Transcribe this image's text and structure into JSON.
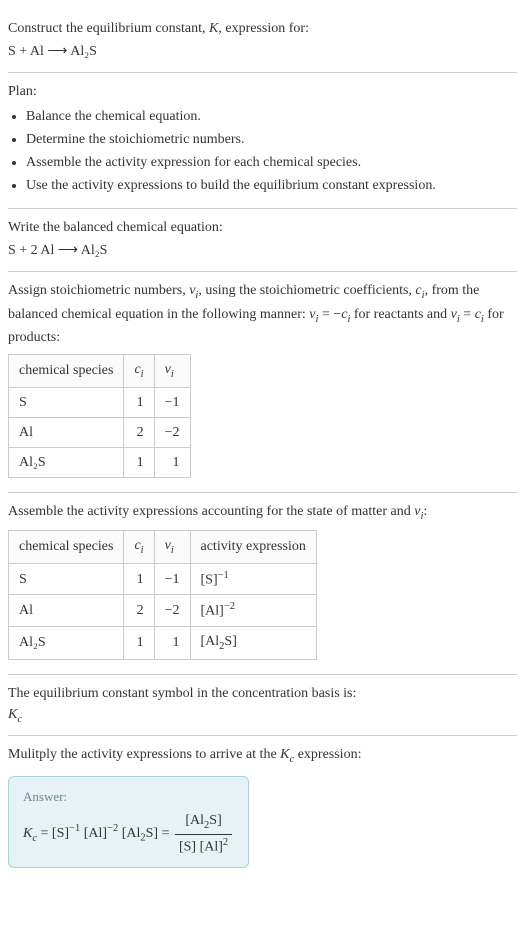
{
  "intro": {
    "line1": "Construct the equilibrium constant, K, expression for:",
    "line2": "S + Al ⟶ Al₂S"
  },
  "plan": {
    "heading": "Plan:",
    "items": [
      "Balance the chemical equation.",
      "Determine the stoichiometric numbers.",
      "Assemble the activity expression for each chemical species.",
      "Use the activity expressions to build the equilibrium constant expression."
    ]
  },
  "balanced": {
    "heading": "Write the balanced chemical equation:",
    "equation": "S + 2 Al ⟶ Al₂S"
  },
  "stoich": {
    "text": "Assign stoichiometric numbers, νᵢ, using the stoichiometric coefficients, cᵢ, from the balanced chemical equation in the following manner: νᵢ = −cᵢ for reactants and νᵢ = cᵢ for products:",
    "headers": {
      "species": "chemical species",
      "ci": "cᵢ",
      "vi": "νᵢ"
    },
    "rows": [
      {
        "species": "S",
        "ci": "1",
        "vi": "−1"
      },
      {
        "species": "Al",
        "ci": "2",
        "vi": "−2"
      },
      {
        "species": "Al₂S",
        "ci": "1",
        "vi": "1"
      }
    ]
  },
  "activity": {
    "text": "Assemble the activity expressions accounting for the state of matter and νᵢ:",
    "headers": {
      "species": "chemical species",
      "ci": "cᵢ",
      "vi": "νᵢ",
      "expr": "activity expression"
    },
    "rows": [
      {
        "species": "S",
        "ci": "1",
        "vi": "−1",
        "expr": "[S]⁻¹"
      },
      {
        "species": "Al",
        "ci": "2",
        "vi": "−2",
        "expr": "[Al]⁻²"
      },
      {
        "species": "Al₂S",
        "ci": "1",
        "vi": "1",
        "expr": "[Al₂S]"
      }
    ]
  },
  "symbol": {
    "text": "The equilibrium constant symbol in the concentration basis is:",
    "value": "K_c"
  },
  "final": {
    "text": "Mulitply the activity expressions to arrive at the K_c expression:",
    "answer_label": "Answer:",
    "lhs": "K_c = [S]⁻¹ [Al]⁻² [Al₂S] =",
    "frac_num": "[Al₂S]",
    "frac_den": "[S] [Al]²"
  }
}
